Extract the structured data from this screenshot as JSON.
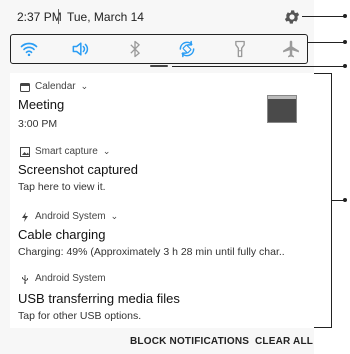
{
  "status": {
    "time": "2:37 PM",
    "date": "Tue, March 14"
  },
  "quick_settings": [
    {
      "name": "wifi",
      "active": true
    },
    {
      "name": "sound",
      "active": true
    },
    {
      "name": "bluetooth",
      "active": false
    },
    {
      "name": "auto-rotate",
      "active": true
    },
    {
      "name": "flashlight",
      "active": false
    },
    {
      "name": "airplane-mode",
      "active": false
    }
  ],
  "notifications": [
    {
      "app": "Calendar",
      "title": "Meeting",
      "text": "3:00 PM"
    },
    {
      "app": "Smart capture",
      "title": "Screenshot captured",
      "text": "Tap here to view it."
    },
    {
      "app": "Android System",
      "title": "Cable charging",
      "text": "Charging: 49% (Approximately 3 h 28 min until fully char.."
    },
    {
      "app": "Android System",
      "title": "USB transferring media files",
      "text": "Tap for other USB options."
    }
  ],
  "actions": {
    "block": "BLOCK NOTIFICATIONS",
    "clear": "CLEAR ALL"
  },
  "colors": {
    "active_icon": "#2a9df4",
    "inactive_icon": "#9a9a9a",
    "accent_dark": "#222222"
  }
}
